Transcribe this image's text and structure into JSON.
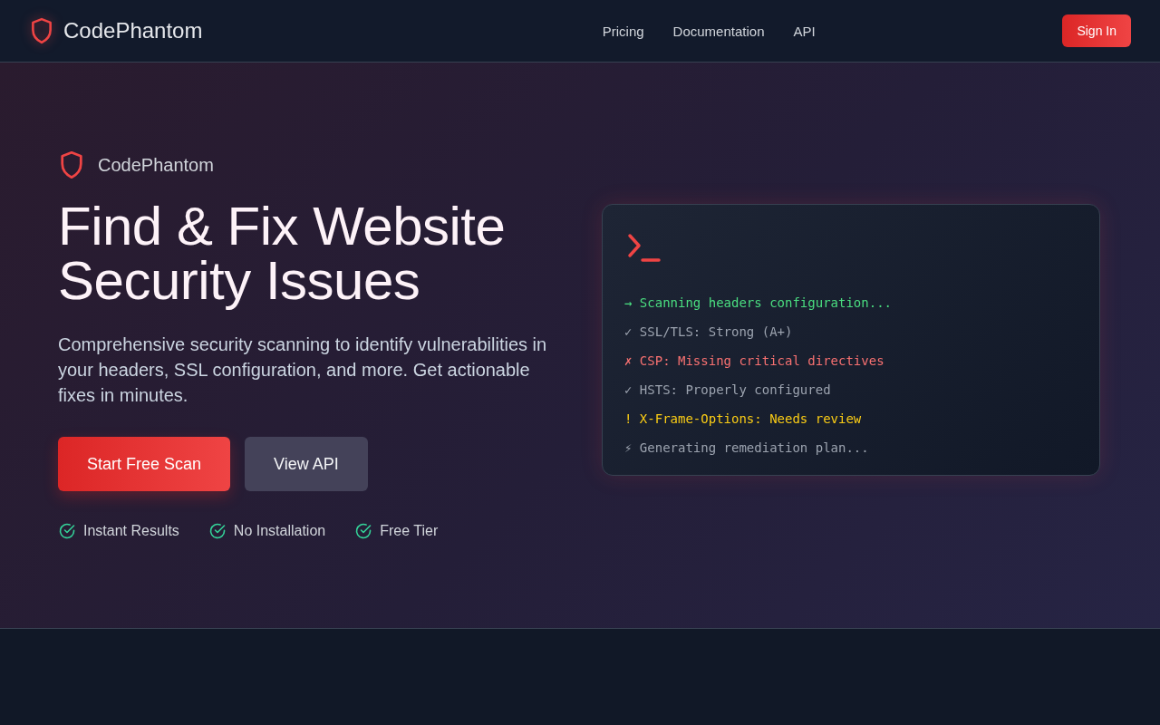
{
  "nav": {
    "brand": "CodePhantom",
    "links": [
      "Pricing",
      "Documentation",
      "API"
    ],
    "sign_in": "Sign In"
  },
  "hero": {
    "brand": "CodePhantom",
    "title_lines": [
      "Find & Fix Website",
      "Security Issues"
    ],
    "description": "Comprehensive security scanning to identify vulnerabilities in your headers, SSL configuration, and more. Get actionable fixes in minutes.",
    "buttons": [
      {
        "label": "Start Free Scan",
        "kind": "primary"
      },
      {
        "label": "View API",
        "kind": "secondary"
      }
    ],
    "features": [
      "Instant Results",
      "No Installation",
      "Free Tier"
    ]
  },
  "terminal": {
    "lines": [
      {
        "text": "→ Scanning headers configuration...",
        "kind": "info"
      },
      {
        "text": "✓ SSL/TLS: Strong (A+)",
        "kind": "ok"
      },
      {
        "text": "✗ CSP: Missing critical directives",
        "kind": "error"
      },
      {
        "text": "✓ HSTS: Properly configured",
        "kind": "ok"
      },
      {
        "text": "! X-Frame-Options: Needs review",
        "kind": "warn"
      },
      {
        "text": "⚡ Generating remediation plan...",
        "kind": "progress"
      }
    ]
  }
}
